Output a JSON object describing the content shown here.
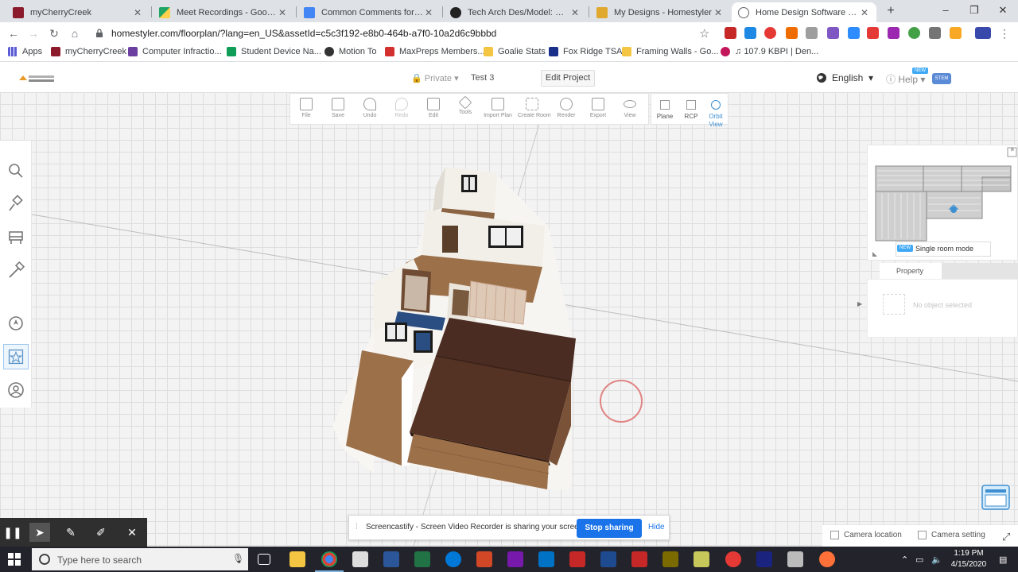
{
  "browser": {
    "tabs": [
      {
        "title": "myCherryCreek",
        "color": "#8b1a2b"
      },
      {
        "title": "Meet Recordings - Google Drive",
        "color": "#1fa463"
      },
      {
        "title": "Common Comments for Remote",
        "color": "#4285f4"
      },
      {
        "title": "Tech Arch Des/Model: Section",
        "color": "#222222"
      },
      {
        "title": "My Designs - Homestyler",
        "color": "#e0a82e"
      },
      {
        "title": "Home Design Software & FREE",
        "color": "#5f6368"
      }
    ],
    "new_tab": "+",
    "window_controls": [
      "–",
      "❐",
      "✕"
    ],
    "url": "homestyler.com/floorplan/?lang=en_US&assetId=c5c3f192-e8b0-464b-a7f0-10a2d6c9bbbd",
    "bookmarks": [
      {
        "label": "Apps",
        "color": "#5b5bd6"
      },
      {
        "label": "myCherryCreek",
        "color": "#8b1a2b"
      },
      {
        "label": "Computer Infractio...",
        "color": "#6b3fa0"
      },
      {
        "label": "Student Device Na...",
        "color": "#0f9d58"
      },
      {
        "label": "Motion To",
        "color": "#333333"
      },
      {
        "label": "MaxPreps Members...",
        "color": "#d32f2f"
      },
      {
        "label": "Goalie Stats",
        "color": "#f4c542"
      },
      {
        "label": "Fox Ridge TSA",
        "color": "#1a2f8a"
      },
      {
        "label": "Framing Walls - Go...",
        "color": "#f4c542"
      },
      {
        "label": "107.9 KBPI | Den...",
        "color": "#c2185b"
      }
    ]
  },
  "app": {
    "privacy": "Private",
    "project_name": "Test 3",
    "edit_project": "Edit Project",
    "language": "English",
    "help": "Help",
    "help_badge": "NEW",
    "toolbar": [
      {
        "label": "File",
        "enabled": true
      },
      {
        "label": "Save",
        "enabled": true
      },
      {
        "label": "Undo",
        "enabled": true
      },
      {
        "label": "Redo",
        "enabled": false
      },
      {
        "label": "Edit",
        "enabled": true
      },
      {
        "label": "Tools",
        "enabled": true
      },
      {
        "label": "Import Plan",
        "enabled": true
      },
      {
        "label": "Create Room",
        "enabled": true
      },
      {
        "label": "Render",
        "enabled": true
      },
      {
        "label": "Export",
        "enabled": true
      },
      {
        "label": "View",
        "enabled": true
      }
    ],
    "view_modes": [
      {
        "label": "Plane",
        "active": false
      },
      {
        "label": "RCP",
        "active": false
      },
      {
        "label": "Orbit View",
        "active": true
      }
    ],
    "left_tools": [
      "search-icon",
      "paint-icon",
      "furniture-icon",
      "build-icon",
      "compass-icon",
      "favorites-icon",
      "account-icon"
    ],
    "minimap": {
      "single_room_badge": "NEW",
      "single_room_label": "Single room mode"
    },
    "property": {
      "tab": "Property",
      "empty": "No object selected"
    },
    "camera": {
      "location": "Camera location",
      "setting": "Camera setting"
    }
  },
  "screencastify": {
    "message": "Screencastify - Screen Video Recorder is sharing your screen.",
    "stop": "Stop sharing",
    "hide": "Hide"
  },
  "taskbar": {
    "search_placeholder": "Type here to search",
    "time": "1:19 PM",
    "date": "4/15/2020"
  }
}
